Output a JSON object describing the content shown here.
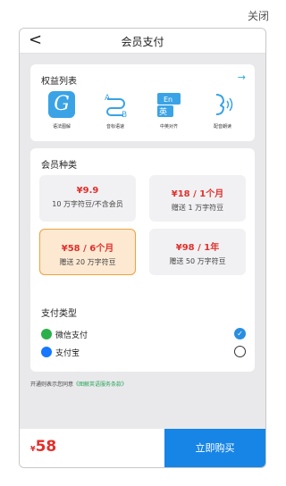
{
  "window": {
    "close_label": "关闭"
  },
  "header": {
    "back_glyph": "<",
    "title": "会员支付"
  },
  "benefits": {
    "title": "权益列表",
    "arrow": "→",
    "items": [
      {
        "icon": "grammar-g-icon",
        "glyph": "G",
        "label": "语法图解"
      },
      {
        "icon": "phonetic-ab-icon",
        "glyph": "",
        "label": "音标语速"
      },
      {
        "icon": "en-cn-align-icon",
        "glyph": "英",
        "label": "中英对齐"
      },
      {
        "icon": "voice-read-icon",
        "glyph": "",
        "label": "配音朗读"
      }
    ]
  },
  "member": {
    "title": "会员种类",
    "plans": [
      {
        "price": "¥9.9",
        "desc": "10 万字符豆/不含会员"
      },
      {
        "price": "¥18 / 1个月",
        "desc": "赠送 1 万字符豆"
      },
      {
        "price": "¥58 / 6个月",
        "desc": "赠送 20 万字符豆"
      },
      {
        "price": "¥98 / 1年",
        "desc": "赠送 50 万字符豆"
      }
    ]
  },
  "payment": {
    "title": "支付类型",
    "methods": [
      {
        "name": "微信支付",
        "icon": "wechat-pay-icon",
        "selected": true
      },
      {
        "name": "支付宝",
        "icon": "alipay-icon",
        "selected": false
      }
    ],
    "check_glyph": "✓"
  },
  "agreement": {
    "text": "开通则表示您同意",
    "link": "《图解英语服务条款》"
  },
  "checkout": {
    "currency": "¥",
    "amount": "58",
    "buy_label": "立即购买"
  },
  "colors": {
    "accent": "#1785e6",
    "price_red": "#e0302c",
    "selected_plan": "#fde9d2"
  }
}
